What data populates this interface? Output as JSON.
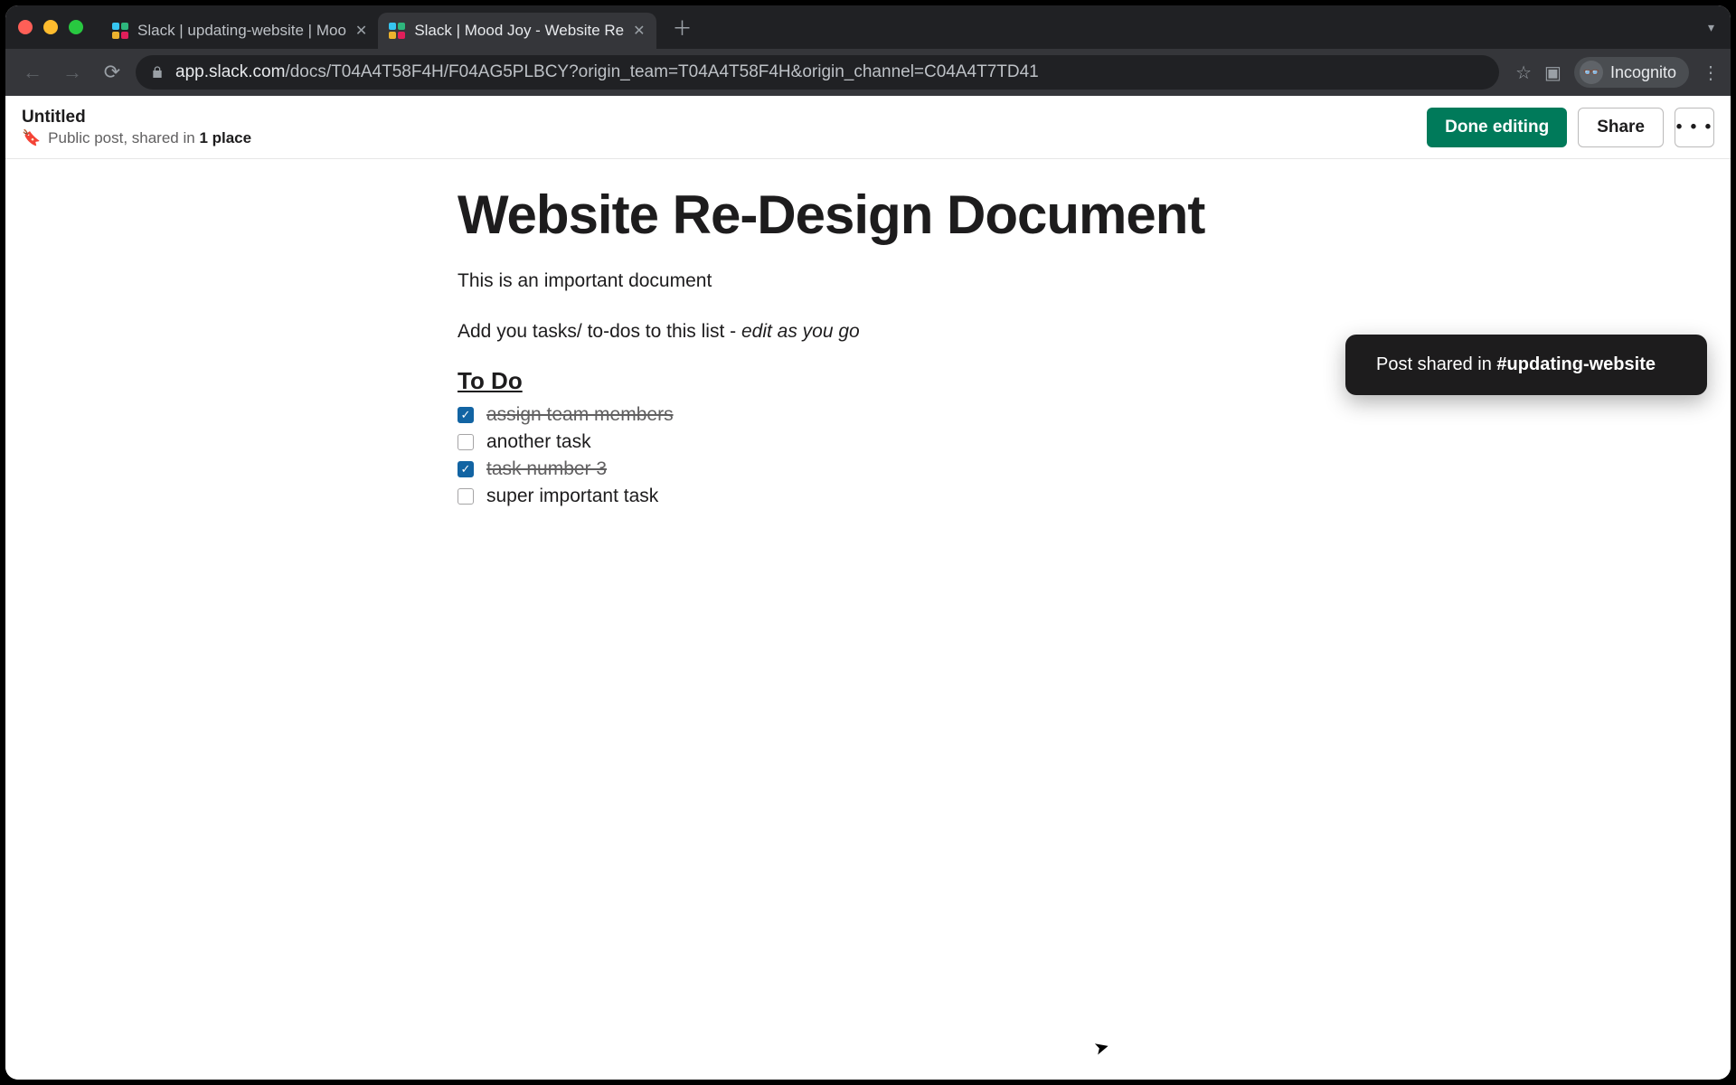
{
  "browser": {
    "tabs": [
      {
        "title": "Slack | updating-website | Moo"
      },
      {
        "title": "Slack | Mood Joy - Website Re"
      }
    ],
    "active_tab_index": 1,
    "url_host": "app.slack.com",
    "url_path": "/docs/T04A4T58F4H/F04AG5PLBCY?origin_team=T04A4T58F4H&origin_channel=C04A4T7TD41",
    "incognito_label": "Incognito"
  },
  "header": {
    "doc_label": "Untitled",
    "meta_prefix": "Public post, shared in ",
    "meta_bold": "1 place",
    "done_label": "Done editing",
    "share_label": "Share"
  },
  "toast": {
    "prefix": "Post shared in ",
    "channel": "#updating-website"
  },
  "document": {
    "title": "Website Re-Design Document",
    "intro": "This is an important document",
    "instructions_plain": "Add you tasks/ to-dos to this list - ",
    "instructions_em": "edit as you go",
    "todo_heading": "To Do ",
    "tasks": [
      {
        "text": "assign team members ",
        "done": true
      },
      {
        "text": "another task",
        "done": false
      },
      {
        "text": "task number 3 ",
        "done": true
      },
      {
        "text": "super important task",
        "done": false
      }
    ]
  },
  "icons": {
    "close": "✕",
    "plus": "＋",
    "caret_down": "▾",
    "back": "←",
    "forward": "→",
    "reload": "⟳",
    "star": "☆",
    "panel": "▣",
    "menu": "⋮",
    "bookmark": "🔖",
    "check": "✓",
    "dots": "• • •",
    "cursor": "➤",
    "mask": "👓"
  }
}
